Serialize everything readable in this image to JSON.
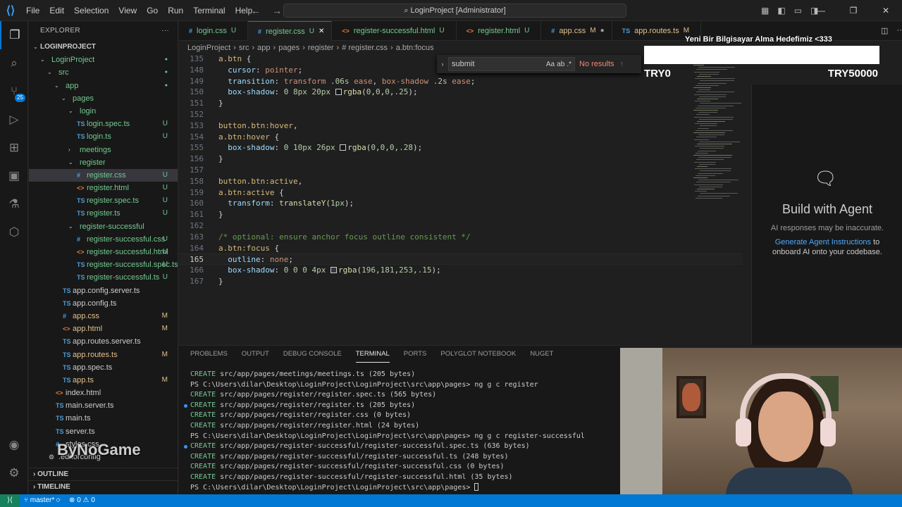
{
  "titlebar": {
    "menu": [
      "File",
      "Edit",
      "Selection",
      "View",
      "Go",
      "Run",
      "Terminal",
      "Help"
    ],
    "search_text": "LoginProject [Administrator]"
  },
  "explorer": {
    "title": "EXPLORER",
    "project_header": "LOGINPROJECT",
    "tree": [
      {
        "label": "LoginProject",
        "depth": 1,
        "type": "folder",
        "open": true,
        "status": ""
      },
      {
        "label": "src",
        "depth": 2,
        "type": "folder",
        "open": true,
        "status": ""
      },
      {
        "label": "app",
        "depth": 3,
        "type": "folder",
        "open": true,
        "status": ""
      },
      {
        "label": "pages",
        "depth": 4,
        "type": "folder",
        "open": true,
        "status": ""
      },
      {
        "label": "login",
        "depth": 5,
        "type": "folder",
        "open": true,
        "status": ""
      },
      {
        "label": "login.spec.ts",
        "depth": 6,
        "type": "ts",
        "status": "U"
      },
      {
        "label": "login.ts",
        "depth": 6,
        "type": "ts",
        "status": "U"
      },
      {
        "label": "meetings",
        "depth": 5,
        "type": "folder",
        "open": false,
        "status": ""
      },
      {
        "label": "register",
        "depth": 5,
        "type": "folder",
        "open": true,
        "status": ""
      },
      {
        "label": "register.css",
        "depth": 6,
        "type": "css",
        "status": "U",
        "selected": true
      },
      {
        "label": "register.html",
        "depth": 6,
        "type": "html",
        "status": "U"
      },
      {
        "label": "register.spec.ts",
        "depth": 6,
        "type": "ts",
        "status": "U"
      },
      {
        "label": "register.ts",
        "depth": 6,
        "type": "ts",
        "status": "U"
      },
      {
        "label": "register-successful",
        "depth": 5,
        "type": "folder",
        "open": true,
        "status": ""
      },
      {
        "label": "register-successful.css",
        "depth": 6,
        "type": "css",
        "status": "U"
      },
      {
        "label": "register-successful.html",
        "depth": 6,
        "type": "html",
        "status": "U"
      },
      {
        "label": "register-successful.spec.ts",
        "depth": 6,
        "type": "ts",
        "status": "U"
      },
      {
        "label": "register-successful.ts",
        "depth": 6,
        "type": "ts",
        "status": "U"
      },
      {
        "label": "app.config.server.ts",
        "depth": 4,
        "type": "ts",
        "status": ""
      },
      {
        "label": "app.config.ts",
        "depth": 4,
        "type": "ts",
        "status": ""
      },
      {
        "label": "app.css",
        "depth": 4,
        "type": "css",
        "status": "M"
      },
      {
        "label": "app.html",
        "depth": 4,
        "type": "html",
        "status": "M"
      },
      {
        "label": "app.routes.server.ts",
        "depth": 4,
        "type": "ts",
        "status": ""
      },
      {
        "label": "app.routes.ts",
        "depth": 4,
        "type": "ts",
        "status": "M"
      },
      {
        "label": "app.spec.ts",
        "depth": 4,
        "type": "ts",
        "status": ""
      },
      {
        "label": "app.ts",
        "depth": 4,
        "type": "ts",
        "status": "M"
      },
      {
        "label": "index.html",
        "depth": 3,
        "type": "html",
        "status": ""
      },
      {
        "label": "main.server.ts",
        "depth": 3,
        "type": "ts",
        "status": ""
      },
      {
        "label": "main.ts",
        "depth": 3,
        "type": "ts",
        "status": ""
      },
      {
        "label": "server.ts",
        "depth": 3,
        "type": "ts",
        "status": ""
      },
      {
        "label": "styles.css",
        "depth": 3,
        "type": "css",
        "status": ""
      },
      {
        "label": ".editorconfig",
        "depth": 2,
        "type": "gear",
        "status": ""
      }
    ],
    "outline_label": "OUTLINE",
    "timeline_label": "TIMELINE",
    "watermark": "ByNoGame"
  },
  "tabs": [
    {
      "label": "login.css",
      "icon": "#",
      "status": "U",
      "type": "css"
    },
    {
      "label": "register.css",
      "icon": "#",
      "status": "U",
      "type": "css",
      "active": true
    },
    {
      "label": "register-successful.html",
      "icon": "<>",
      "status": "U",
      "type": "html"
    },
    {
      "label": "register.html",
      "icon": "<>",
      "status": "U",
      "type": "html"
    },
    {
      "label": "app.css",
      "icon": "#",
      "status": "M",
      "type": "css",
      "dirty": true
    },
    {
      "label": "app.routes.ts",
      "icon": "TS",
      "status": "M",
      "type": "ts"
    }
  ],
  "breadcrumb": [
    "LoginProject",
    "src",
    "app",
    "pages",
    "register",
    "# register.css",
    "a.btn:focus"
  ],
  "find": {
    "query": "submit",
    "result": "No results",
    "opt_case": "Aa",
    "opt_word": "ab",
    "opt_regex": ".*"
  },
  "editor": {
    "lines": [
      {
        "n": "135",
        "html": "<span class='sel-c'>a.btn</span> <span class='pun'>{</span>"
      },
      {
        "n": "148",
        "html": "  <span class='prop'>cursor</span>: <span class='val'>pointer</span>;"
      },
      {
        "n": "149",
        "html": "  <span class='prop'>transition</span>: <span class='val'>transform</span> <span class='num'>.06s</span> <span class='val'>ease</span>, <span class='val'>box-shadow</span> <span class='num'>.2s</span> <span class='val'>ease</span>;"
      },
      {
        "n": "150",
        "html": "  <span class='prop'>box-shadow</span>: <span class='num'>0</span> <span class='num'>8px</span> <span class='num'>20px</span> <span class='swatch' style='background:rgba(0,0,0,.25)'></span><span class='kw'>rgba</span>(<span class='num'>0</span>,<span class='num'>0</span>,<span class='num'>0</span>,<span class='num'>.25</span>);"
      },
      {
        "n": "151",
        "html": "}"
      },
      {
        "n": "152",
        "html": ""
      },
      {
        "n": "153",
        "html": "<span class='sel-c'>button.btn:hover</span>,"
      },
      {
        "n": "154",
        "html": "<span class='sel-c'>a.btn:hover</span> {"
      },
      {
        "n": "155",
        "html": "  <span class='prop'>box-shadow</span>: <span class='num'>0</span> <span class='num'>10px</span> <span class='num'>26px</span> <span class='swatch' style='background:rgba(0,0,0,.28)'></span><span class='kw'>rgba</span>(<span class='num'>0</span>,<span class='num'>0</span>,<span class='num'>0</span>,<span class='num'>.28</span>);"
      },
      {
        "n": "156",
        "html": "}"
      },
      {
        "n": "157",
        "html": ""
      },
      {
        "n": "158",
        "html": "<span class='sel-c'>button.btn:active</span>,"
      },
      {
        "n": "159",
        "html": "<span class='sel-c'>a.btn:active</span> {"
      },
      {
        "n": "160",
        "html": "  <span class='prop'>transform</span>: <span class='kw'>translateY</span>(<span class='num'>1px</span>);"
      },
      {
        "n": "161",
        "html": "}"
      },
      {
        "n": "162",
        "html": ""
      },
      {
        "n": "163",
        "html": "<span class='cm'>/* optional: ensure anchor focus outline consistent */</span>"
      },
      {
        "n": "164",
        "html": "<span class='sel-c'>a.btn:focus</span> {"
      },
      {
        "n": "165",
        "html": "  <span class='prop'>outline</span>: <span class='val'>none</span>;",
        "current": true
      },
      {
        "n": "166",
        "html": "  <span class='prop'>box-shadow</span>: <span class='num'>0</span> <span class='num'>0</span> <span class='num'>0</span> <span class='num'>4px</span> <span class='swatch' style='background:rgba(196,181,253,.15)'></span><span class='kw'>rgba</span>(<span class='num'>196</span>,<span class='num'>181</span>,<span class='num'>253</span>,<span class='num'>.15</span>);"
      },
      {
        "n": "167",
        "html": "}"
      }
    ]
  },
  "donation": {
    "title": "Yeni Bir Bilgisayar Alma Hedefimiz <333",
    "current": "TRY0",
    "goal": "TRY50000",
    "progress": 0
  },
  "chat": {
    "title": "Build with Agent",
    "note": "AI responses may be inaccurate.",
    "link": "Generate Agent Instructions",
    "link_suffix": " to",
    "line2": "onboard AI onto your codebase."
  },
  "panel": {
    "tabs": [
      "PROBLEMS",
      "OUTPUT",
      "DEBUG CONSOLE",
      "TERMINAL",
      "PORTS",
      "POLYGLOT NOTEBOOK",
      "NUGET"
    ],
    "active_tab": "TERMINAL",
    "terminal": [
      {
        "dot": false,
        "kind": "create",
        "text": "src/app/pages/meetings/meetings.ts (205 bytes)"
      },
      {
        "dot": false,
        "kind": "ps",
        "text": "PS C:\\Users\\dilar\\Desktop\\LoginProject\\LoginProject\\src\\app\\pages> ng g c register"
      },
      {
        "dot": false,
        "kind": "create",
        "text": "src/app/pages/register/register.spec.ts (565 bytes)"
      },
      {
        "dot": true,
        "kind": "create",
        "text": "src/app/pages/register/register.ts (205 bytes)"
      },
      {
        "dot": false,
        "kind": "create",
        "text": "src/app/pages/register/register.css (0 bytes)"
      },
      {
        "dot": false,
        "kind": "create",
        "text": "src/app/pages/register/register.html (24 bytes)"
      },
      {
        "dot": false,
        "kind": "ps",
        "text": "PS C:\\Users\\dilar\\Desktop\\LoginProject\\LoginProject\\src\\app\\pages> ng g c register-successful"
      },
      {
        "dot": true,
        "kind": "create",
        "text": "src/app/pages/register-successful/register-successful.spec.ts (636 bytes)"
      },
      {
        "dot": false,
        "kind": "create",
        "text": "src/app/pages/register-successful/register-successful.ts (248 bytes)"
      },
      {
        "dot": false,
        "kind": "create",
        "text": "src/app/pages/register-successful/register-successful.css (0 bytes)"
      },
      {
        "dot": false,
        "kind": "create",
        "text": "src/app/pages/register-successful/register-successful.html (35 bytes)"
      },
      {
        "dot": false,
        "kind": "prompt",
        "text": "PS C:\\Users\\dilar\\Desktop\\LoginProject\\LoginProject\\src\\app\\pages> "
      }
    ],
    "create_word": "CREATE"
  },
  "statusbar": {
    "branch": "master*",
    "errors": "0",
    "warnings": "0"
  }
}
